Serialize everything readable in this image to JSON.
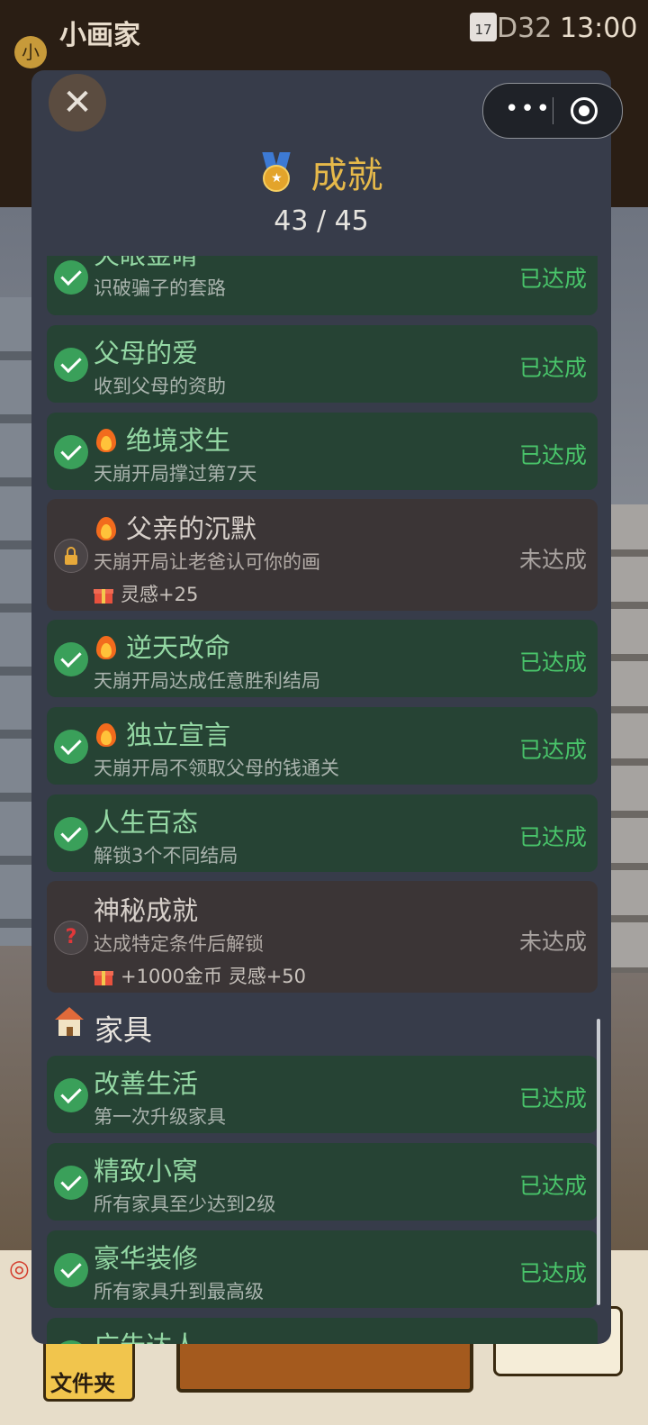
{
  "background": {
    "app_title": "小画家",
    "avatar_char": "小",
    "calendar_day": "17",
    "day_label": "D32",
    "time": "13:00",
    "folder_label": "文件夹"
  },
  "modal": {
    "close_icon": "close-icon",
    "title": "成就",
    "progress": "43 / 45",
    "achievements": [
      {
        "name": "火眼金睛",
        "desc": "识破骗子的套路",
        "status": "已达成",
        "done": true,
        "fire": false
      },
      {
        "name": "父母的爱",
        "desc": "收到父母的资助",
        "status": "已达成",
        "done": true,
        "fire": false
      },
      {
        "name": "绝境求生",
        "desc": "天崩开局撑过第7天",
        "status": "已达成",
        "done": true,
        "fire": true
      },
      {
        "name": "父亲的沉默",
        "desc": "天崩开局让老爸认可你的画",
        "reward": "灵感+25",
        "status": "未达成",
        "done": false,
        "fire": true
      },
      {
        "name": "逆天改命",
        "desc": "天崩开局达成任意胜利结局",
        "status": "已达成",
        "done": true,
        "fire": true
      },
      {
        "name": "独立宣言",
        "desc": "天崩开局不领取父母的钱通关",
        "status": "已达成",
        "done": true,
        "fire": true
      },
      {
        "name": "人生百态",
        "desc": "解锁3个不同结局",
        "status": "已达成",
        "done": true,
        "fire": false
      },
      {
        "name": "神秘成就",
        "desc": "达成特定条件后解锁",
        "reward": "+1000金币 灵感+50",
        "status": "未达成",
        "done": false,
        "fire": false
      }
    ],
    "furniture_section": {
      "title": "家具",
      "items": [
        {
          "name": "改善生活",
          "desc": "第一次升级家具",
          "status": "已达成"
        },
        {
          "name": "精致小窝",
          "desc": "所有家具至少达到2级",
          "status": "已达成"
        },
        {
          "name": "豪华装修",
          "desc": "所有家具升到最高级",
          "status": "已达成"
        },
        {
          "name": "广告达人",
          "desc": "",
          "status": ""
        }
      ]
    }
  }
}
